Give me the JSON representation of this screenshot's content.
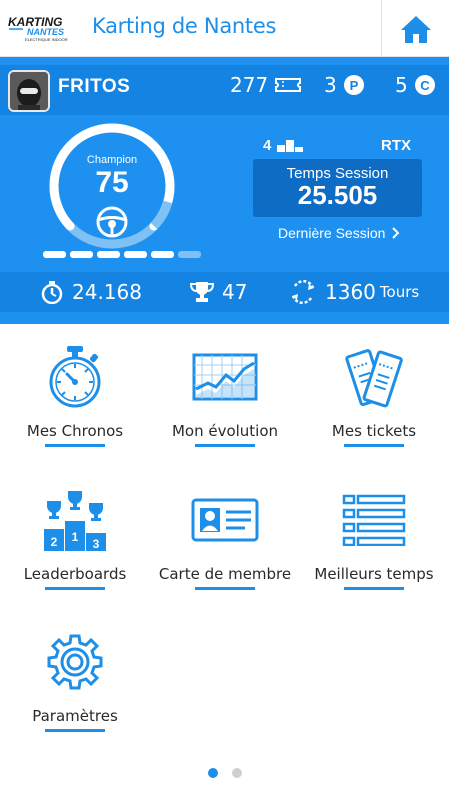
{
  "header": {
    "logo_text_top": "KARTING",
    "logo_text_mid": "NANTES",
    "logo_text_sub": "ELECTRIQUE INDOOR",
    "title": "Karting de Nantes"
  },
  "profile": {
    "username": "FRITOS",
    "tickets": "277",
    "points": "3",
    "credits": "5",
    "level_name": "Champion",
    "level": "75",
    "progress_segments": 6,
    "progress_filled": 5,
    "rank": "4",
    "kart": "RTX",
    "session_label": "Temps Session",
    "session_time": "25.505",
    "last_session_label": "Dernière Session",
    "best_time": "24.168",
    "trophies": "47",
    "laps": "1360",
    "laps_unit": "Tours"
  },
  "menu": [
    {
      "label": "Mes Chronos",
      "icon": "stopwatch-icon"
    },
    {
      "label": "Mon évolution",
      "icon": "line-chart-icon"
    },
    {
      "label": "Mes tickets",
      "icon": "tickets-icon"
    },
    {
      "label": "Leaderboards",
      "icon": "podium-icon"
    },
    {
      "label": "Carte de membre",
      "icon": "member-card-icon"
    },
    {
      "label": "Meilleurs temps",
      "icon": "list-icon"
    },
    {
      "label": "Paramètres",
      "icon": "gear-icon"
    }
  ],
  "pagination": {
    "pages": 2,
    "active": 1
  },
  "colors": {
    "accent": "#1e8fe8",
    "hero": "#1e90f0",
    "hero_band": "#1583e2",
    "session_box": "#0f6cc5"
  }
}
